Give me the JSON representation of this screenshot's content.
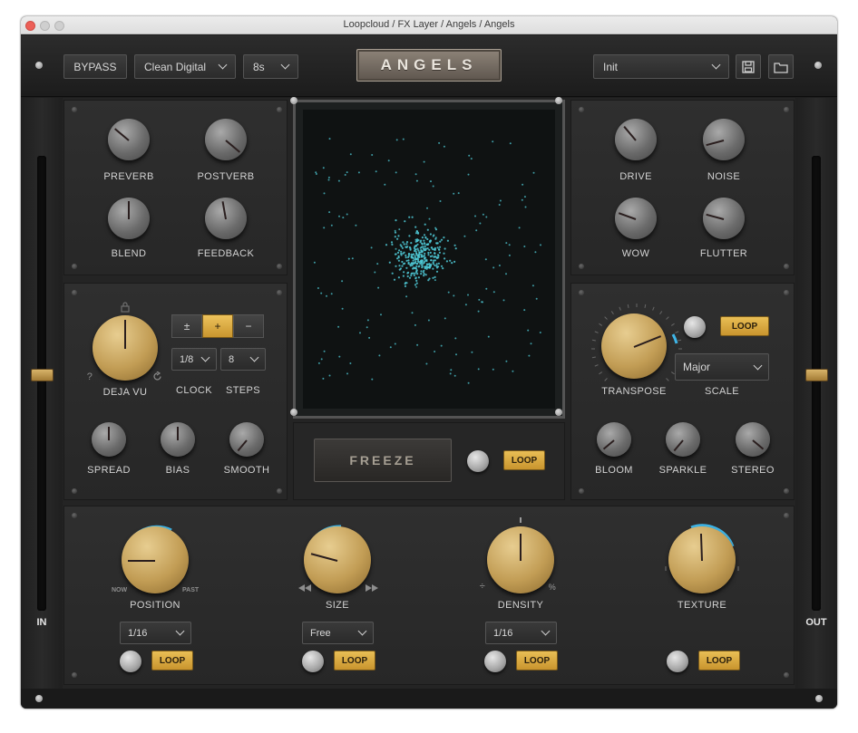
{
  "window": {
    "title": "Loopcloud / FX Layer / Angels / Angels"
  },
  "header": {
    "bypass_label": "BYPASS",
    "mode_value": "Clean Digital",
    "time_value": "8s",
    "logo_text": "ANGELS",
    "preset_value": "Init",
    "save_icon": "save-icon",
    "folder_icon": "folder-icon"
  },
  "rails": {
    "in_label": "IN",
    "out_label": "OUT"
  },
  "left_top": {
    "preverb": "PREVERB",
    "postverb": "POSTVERB",
    "blend": "BLEND",
    "feedback": "FEEDBACK"
  },
  "deja": {
    "deja_vu": "DEJA VU",
    "question": "?",
    "seg_plusminus": "±",
    "seg_plus": "+",
    "seg_minus": "−",
    "clock_value": "1/8",
    "steps_value": "8",
    "clock": "CLOCK",
    "steps": "STEPS",
    "spread": "SPREAD",
    "bias": "BIAS",
    "smooth": "SMOOTH"
  },
  "right_top": {
    "drive": "DRIVE",
    "noise": "NOISE",
    "wow": "WOW",
    "flutter": "FLUTTER"
  },
  "transpose": {
    "transpose": "TRANSPOSE",
    "scale": "SCALE",
    "scale_value": "Major",
    "loop": "LOOP",
    "bloom": "BLOOM",
    "sparkle": "SPARKLE",
    "stereo": "STEREO"
  },
  "freeze": {
    "label": "FREEZE",
    "loop": "LOOP"
  },
  "bottom": {
    "position": "POSITION",
    "position_now": "NOW",
    "position_past": "PAST",
    "position_div": "1/16",
    "size": "SIZE",
    "size_mode": "Free",
    "density": "DENSITY",
    "density_div": "1/16",
    "density_left": "÷",
    "density_right": "%",
    "texture": "TEXTURE",
    "loop": "LOOP"
  },
  "colors": {
    "accent_gold": "#e2b24a",
    "particle_cyan": "#4fc9d6",
    "ring_blue": "#3fb6e8"
  }
}
